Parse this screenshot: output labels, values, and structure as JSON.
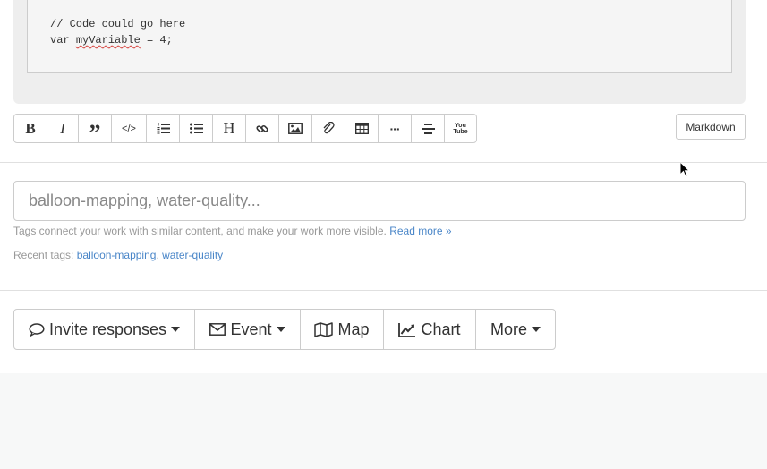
{
  "editor": {
    "code_lines": [
      "// Code could go here",
      "var ",
      "myVariable",
      " = 4;"
    ]
  },
  "toolbar": {
    "buttons": [
      {
        "name": "bold",
        "glyph": "B"
      },
      {
        "name": "italic",
        "glyph": "I"
      },
      {
        "name": "quote",
        "glyph": "”"
      },
      {
        "name": "code",
        "glyph": "</>"
      },
      {
        "name": "ordered-list"
      },
      {
        "name": "unordered-list"
      },
      {
        "name": "header",
        "glyph": "H"
      },
      {
        "name": "link"
      },
      {
        "name": "image"
      },
      {
        "name": "attachment"
      },
      {
        "name": "table"
      },
      {
        "name": "horizontal-rule",
        "glyph": "···"
      },
      {
        "name": "center"
      },
      {
        "name": "youtube",
        "glyph": "You\nTube"
      }
    ],
    "markdown_label": "Markdown"
  },
  "tags": {
    "placeholder": "balloon-mapping, water-quality...",
    "help_text": "Tags connect your work with similar content, and make your work more visible.",
    "read_more": "Read more »",
    "recent_label": "Recent tags:",
    "recent": [
      "balloon-mapping",
      "water-quality"
    ],
    "separator": ","
  },
  "actions": {
    "invite": "Invite responses",
    "event": "Event",
    "map": "Map",
    "chart": "Chart",
    "more": "More"
  },
  "colors": {
    "link": "#4a86c8",
    "border": "#cccccc",
    "muted_text": "#999999"
  }
}
